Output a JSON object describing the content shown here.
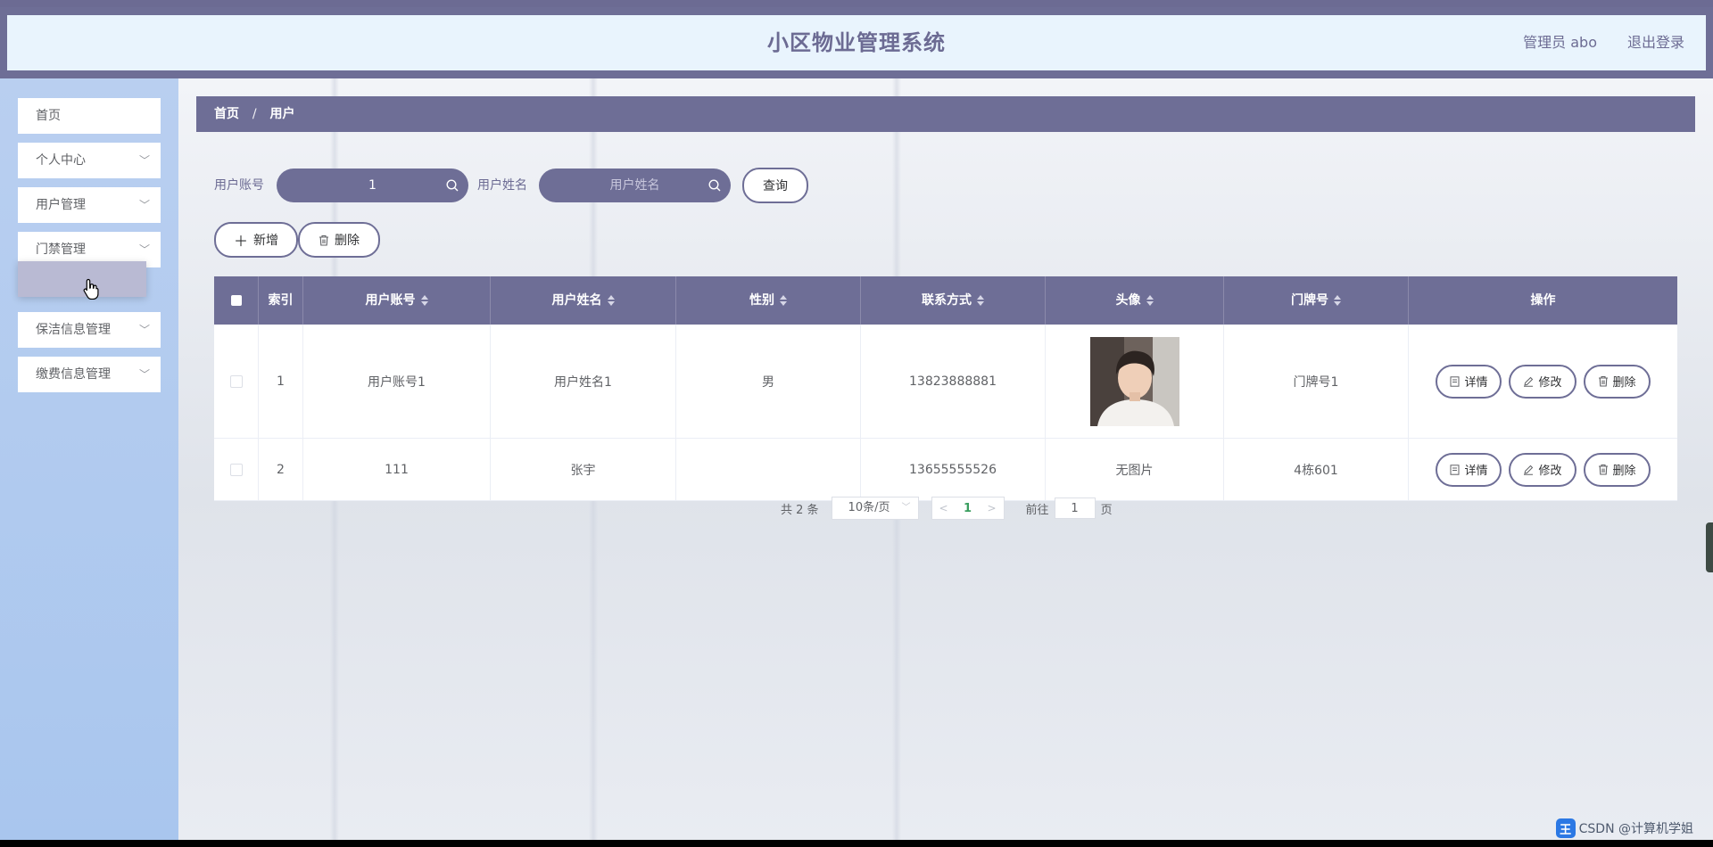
{
  "header": {
    "title": "小区物业管理系统",
    "user": "管理员 abo",
    "logout": "退出登录"
  },
  "sidebar": {
    "items": [
      {
        "label": "首页",
        "has_children": false
      },
      {
        "label": "个人中心",
        "has_children": true
      },
      {
        "label": "用户管理",
        "has_children": true
      },
      {
        "label": "门禁管理",
        "has_children": true
      },
      {
        "label": "保洁信息管理",
        "has_children": true
      },
      {
        "label": "缴费信息管理",
        "has_children": true
      }
    ]
  },
  "breadcrumb": {
    "home": "首页",
    "separator": "/",
    "current": "用户"
  },
  "search": {
    "account_label": "用户账号",
    "account_value": "1",
    "name_label": "用户姓名",
    "name_placeholder": "用户姓名",
    "query_button": "查询"
  },
  "actions": {
    "add": "新增",
    "delete": "删除"
  },
  "table": {
    "columns": [
      "索引",
      "用户账号",
      "用户姓名",
      "性别",
      "联系方式",
      "头像",
      "门牌号",
      "操作"
    ],
    "rows": [
      {
        "index": "1",
        "account": "用户账号1",
        "name": "用户姓名1",
        "gender": "男",
        "phone": "13823888881",
        "avatar": "image",
        "door": "门牌号1"
      },
      {
        "index": "2",
        "account": "111",
        "name": "张宇",
        "gender": "",
        "phone": "13655555526",
        "avatar": "无图片",
        "door": "4栋601"
      }
    ],
    "op_buttons": {
      "detail": "详情",
      "edit": "修改",
      "delete": "删除"
    }
  },
  "pagination": {
    "total": "共 2 条",
    "page_size": "10条/页",
    "current_page": "1",
    "goto_prefix": "前往",
    "goto_value": "1",
    "goto_suffix": "页"
  },
  "watermark": {
    "badge": "王",
    "text": "CSDN @计算机学姐"
  },
  "colors": {
    "primary": "#6e6e96",
    "header_bg": "#e9f4fd",
    "sidebar_bg": "#b3cbef",
    "active_page": "#3a9e5f"
  }
}
